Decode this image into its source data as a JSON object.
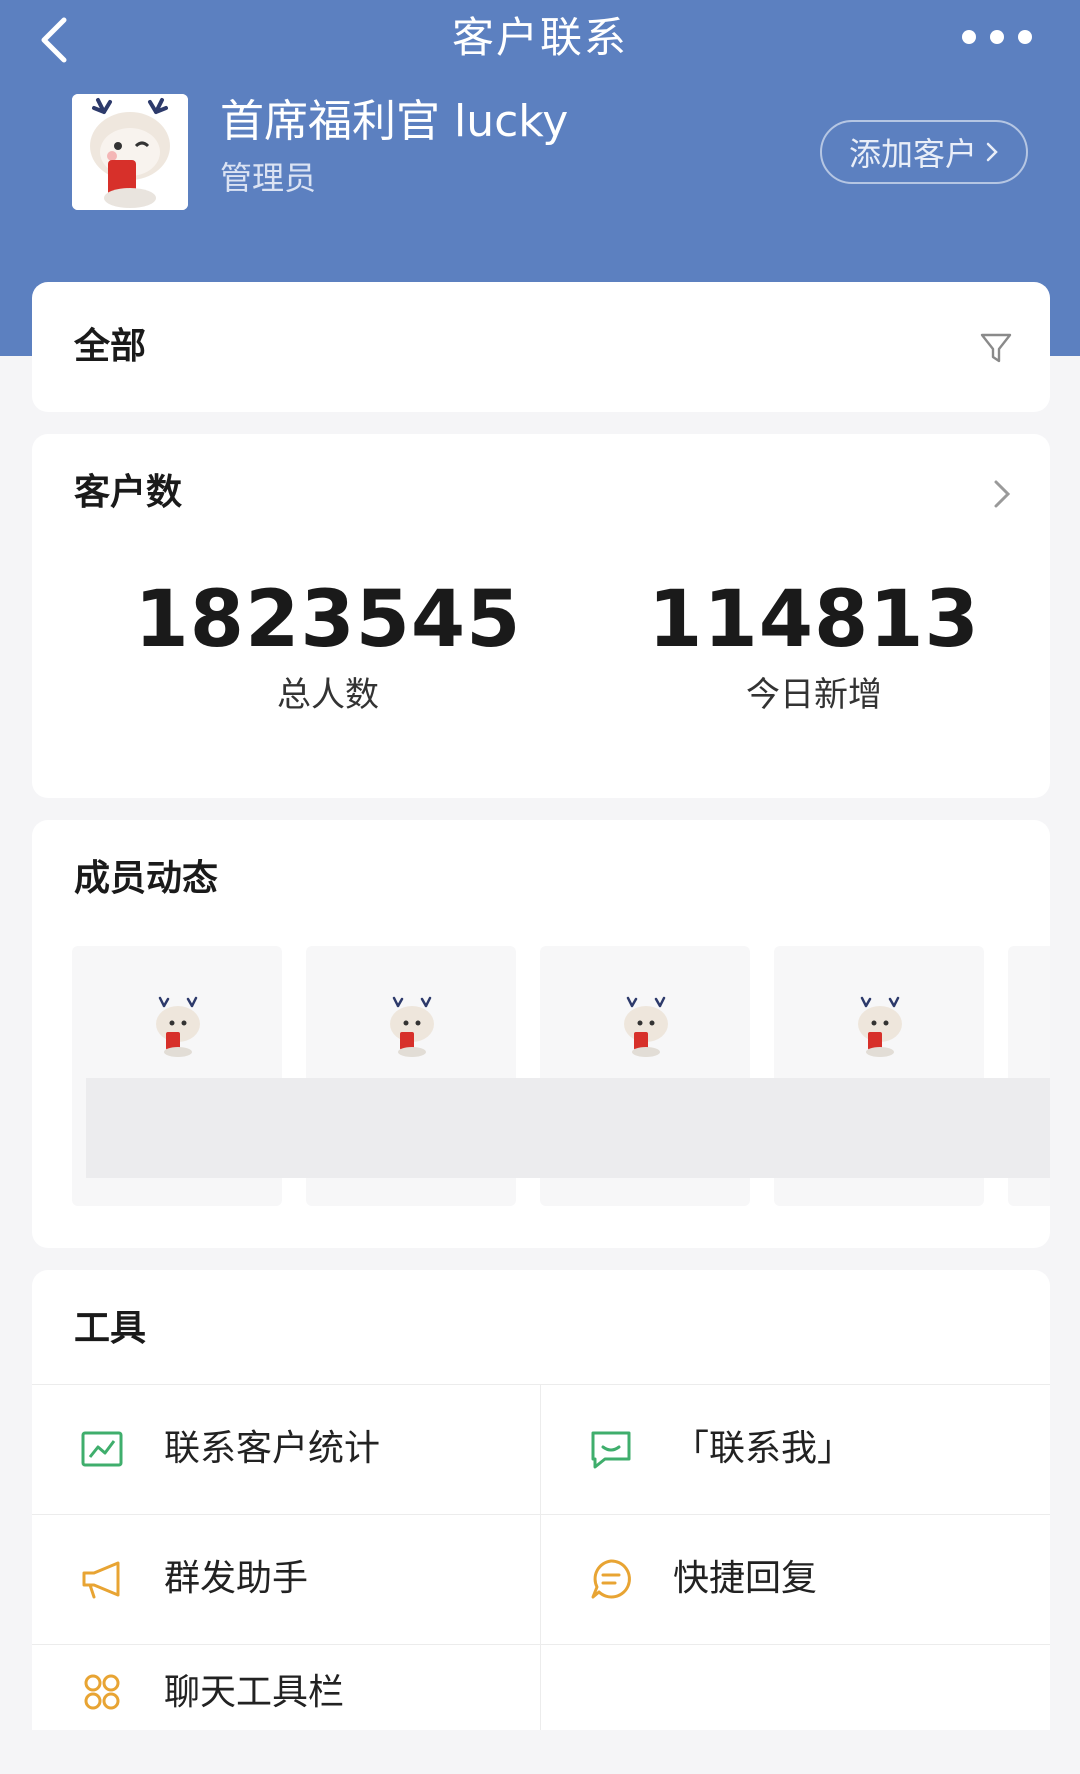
{
  "nav": {
    "title": "客户联系"
  },
  "profile": {
    "name": "首席福利官 lucky",
    "role": "管理员",
    "add_button": "添加客户"
  },
  "filter": {
    "label": "全部"
  },
  "stats": {
    "title": "客户数",
    "total_value": "1823545",
    "total_label": "总人数",
    "today_value": "114813",
    "today_label": "今日新增"
  },
  "members": {
    "title": "成员动态",
    "tile_count_visible": 5
  },
  "tools": {
    "title": "工具",
    "items": [
      {
        "label": "联系客户统计",
        "icon": "chart-icon"
      },
      {
        "label": "「联系我」",
        "icon": "message-icon"
      },
      {
        "label": "群发助手",
        "icon": "megaphone-icon"
      },
      {
        "label": "快捷回复",
        "icon": "quick-reply-icon"
      },
      {
        "label": "聊天工具栏",
        "icon": "toolbar-icon"
      }
    ]
  },
  "colors": {
    "header": "#5c80c0",
    "tool_green": "#3fae6c",
    "tool_orange": "#e8a433"
  }
}
